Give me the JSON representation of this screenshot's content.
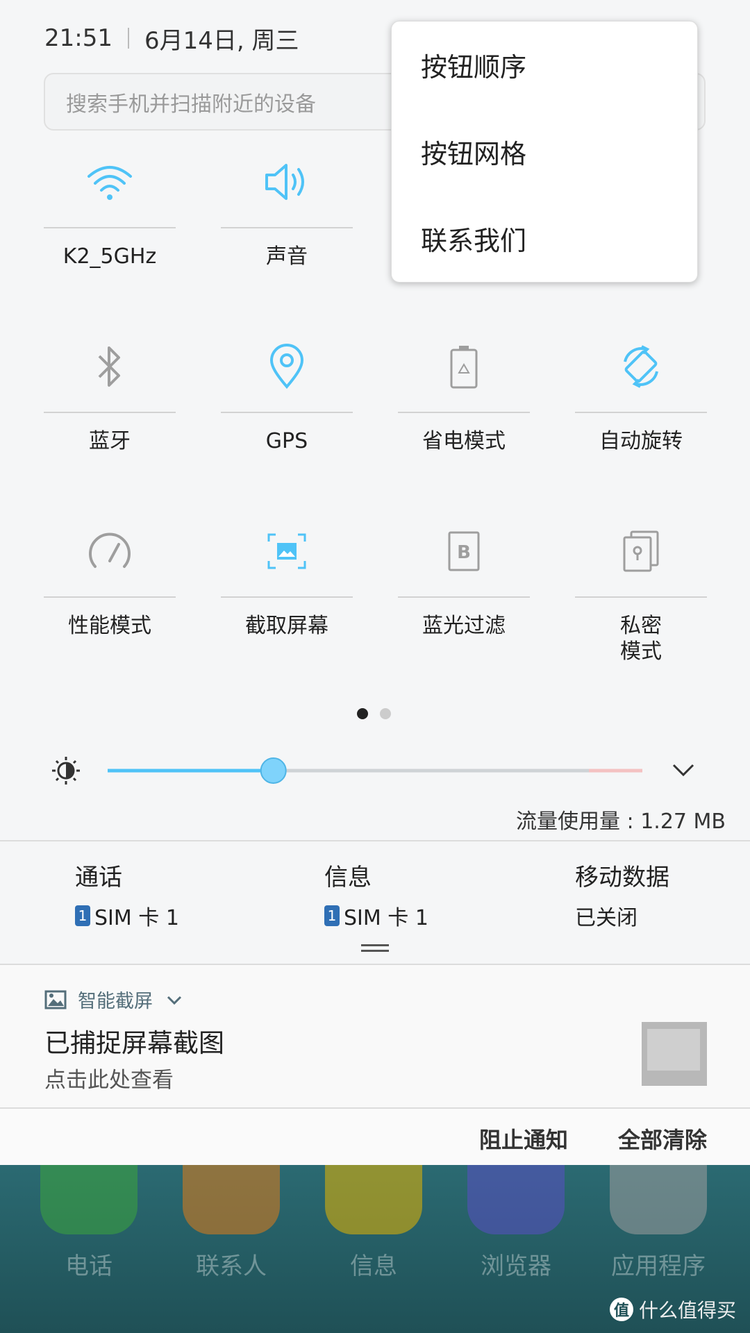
{
  "status": {
    "time": "21:51",
    "date": "6月14日, 周三"
  },
  "search": {
    "placeholder": "搜索手机并扫描附近的设备"
  },
  "tiles": [
    {
      "label": "K2_5GHz",
      "icon": "wifi-icon",
      "active": true
    },
    {
      "label": "声音",
      "icon": "sound-icon",
      "active": true
    },
    {
      "label": "蓝牙",
      "icon": "bluetooth-icon",
      "active": false
    },
    {
      "label": "GPS",
      "icon": "location-icon",
      "active": true
    },
    {
      "label": "省电模式",
      "icon": "battery-saver-icon",
      "active": false
    },
    {
      "label": "自动旋转",
      "icon": "auto-rotate-icon",
      "active": true
    },
    {
      "label": "性能模式",
      "icon": "speedometer-icon",
      "active": false
    },
    {
      "label": "截取屏幕",
      "icon": "screenshot-icon",
      "active": true
    },
    {
      "label": "蓝光过滤",
      "icon": "blue-light-filter-icon",
      "active": false
    },
    {
      "label": "私密\n模式",
      "icon": "private-mode-icon",
      "active": false
    }
  ],
  "page_indicator": {
    "current": 1,
    "total": 2
  },
  "brightness": {
    "level": 0.31
  },
  "data_usage": "流量使用量 : 1.27 MB",
  "sim": [
    {
      "title": "通话",
      "badge": "1",
      "value": "SIM 卡 1"
    },
    {
      "title": "信息",
      "badge": "1",
      "value": "SIM 卡 1"
    },
    {
      "title": "移动数据",
      "value": "已关闭"
    }
  ],
  "notification": {
    "app": "智能截屏",
    "title": "已捕捉屏幕截图",
    "subtitle": "点击此处查看"
  },
  "actions": {
    "block": "阻止通知",
    "clear": "全部清除"
  },
  "home_apps": [
    {
      "label": "电话",
      "color": "#3ca63c"
    },
    {
      "label": "联系人",
      "color": "#e07b18"
    },
    {
      "label": "信息",
      "color": "#e6b400"
    },
    {
      "label": "浏览器",
      "color": "#5a4fc4"
    },
    {
      "label": "应用程序",
      "color": "#9e9e9e"
    }
  ],
  "menu": {
    "items": [
      "按钮顺序",
      "按钮网格",
      "联系我们"
    ]
  },
  "watermark": {
    "badge": "值",
    "text": "什么值得买"
  },
  "colors": {
    "accent": "#4fc3f7",
    "inactive": "#9e9e9e"
  }
}
